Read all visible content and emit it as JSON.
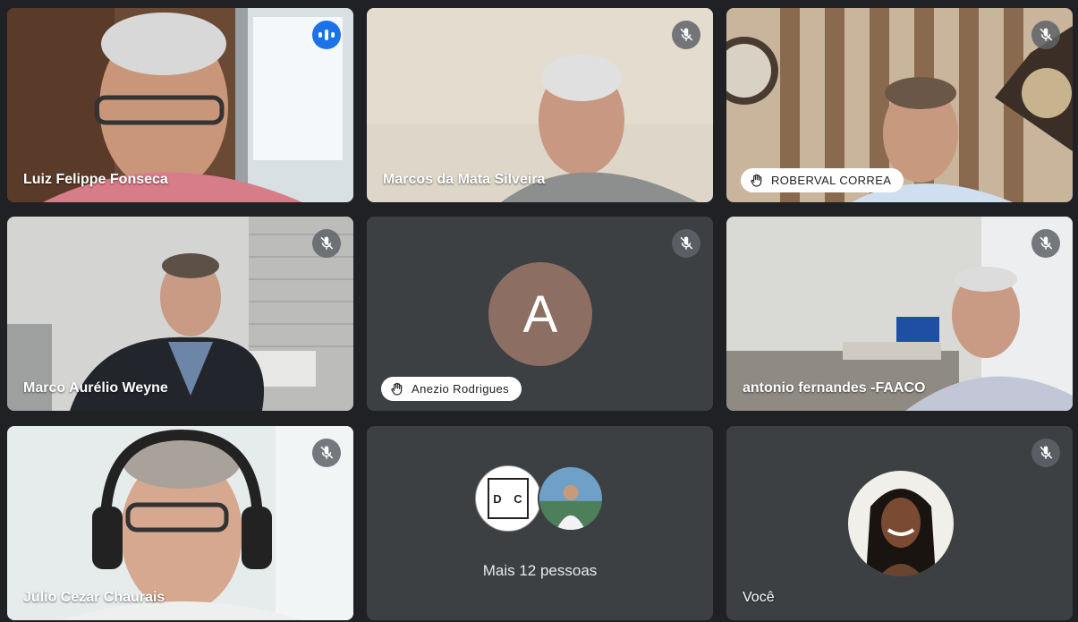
{
  "meeting": {
    "participants": [
      {
        "name": "Luiz Felippe Fonseca",
        "muted": false,
        "speaking": true
      },
      {
        "name": "Marcos da Mata Silveira",
        "muted": true
      },
      {
        "name": "ROBERVAL CORREA",
        "muted": true,
        "hand_raised": true
      },
      {
        "name": "Marco Aurélio Weyne",
        "muted": true
      },
      {
        "name": "Anezio Rodrigues",
        "muted": true,
        "hand_raised": true,
        "avatar_letter": "A",
        "avatar_color": "#8d6e63"
      },
      {
        "name": "antonio fernandes -FAACO",
        "muted": true
      },
      {
        "name": "Júlio Cezar Chaurais",
        "muted": true
      },
      {
        "name": "Você",
        "muted": true
      }
    ],
    "overflow": {
      "label": "Mais 12 pessoas",
      "avatar_initials": "D C"
    },
    "colors": {
      "background": "#202124",
      "tile": "#3c4043",
      "speaking_border": "#8ab4f8",
      "speaking_indicator": "#1a73e8"
    },
    "icons": {
      "muted": "mic-off-icon",
      "hand": "raised-hand-icon",
      "speaking": "audio-level-icon"
    }
  }
}
